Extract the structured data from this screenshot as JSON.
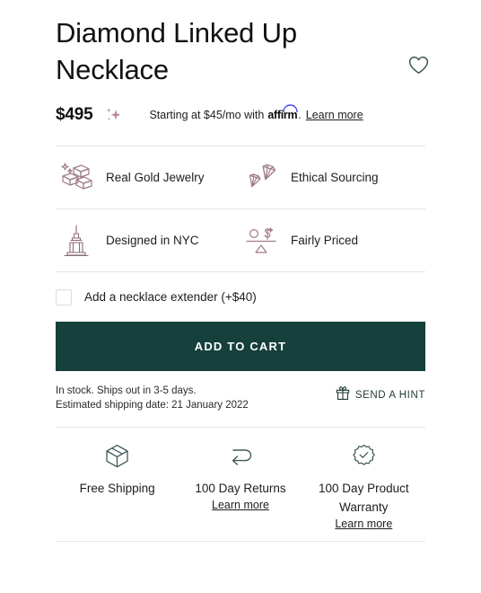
{
  "product": {
    "title": "Diamond Linked Up Necklace",
    "price": "$495",
    "wishlist_icon": "heart-icon",
    "sparkle_icon": "sparkle-icon"
  },
  "financing": {
    "prefix": "Starting at $45/mo with",
    "provider": "affirm",
    "suffix": ".",
    "learn_more": "Learn more"
  },
  "features": [
    {
      "label": "Real Gold Jewelry",
      "icon": "gold-bars-icon"
    },
    {
      "label": "Ethical Sourcing",
      "icon": "diamonds-icon"
    },
    {
      "label": "Designed in NYC",
      "icon": "empire-state-building-icon"
    },
    {
      "label": "Fairly Priced",
      "icon": "balance-scale-icon"
    }
  ],
  "options": {
    "extender_label": "Add a necklace extender (+$40)",
    "extender_checked": false
  },
  "cart": {
    "add_to_cart_label": "ADD TO CART"
  },
  "availability": {
    "stock_line": "In stock. Ships out in 3-5 days.",
    "shipping_line": "Estimated shipping date: 21 January 2022"
  },
  "hint": {
    "label": "SEND A HINT",
    "icon": "gift-icon"
  },
  "trust_badges": [
    {
      "label": "Free Shipping",
      "icon": "package-box-icon",
      "learn_more": ""
    },
    {
      "label": "100 Day Returns",
      "icon": "return-arrow-icon",
      "learn_more": "Learn more"
    },
    {
      "label": "100 Day Product Warranty",
      "icon": "warranty-seal-icon",
      "learn_more": "Learn more"
    }
  ],
  "colors": {
    "accent_button": "#16403c",
    "icon_mauve": "#9e7a84",
    "icon_slate": "#3e5a57",
    "affirm_arc": "#4a4af4",
    "divider": "#e6e6e6"
  }
}
